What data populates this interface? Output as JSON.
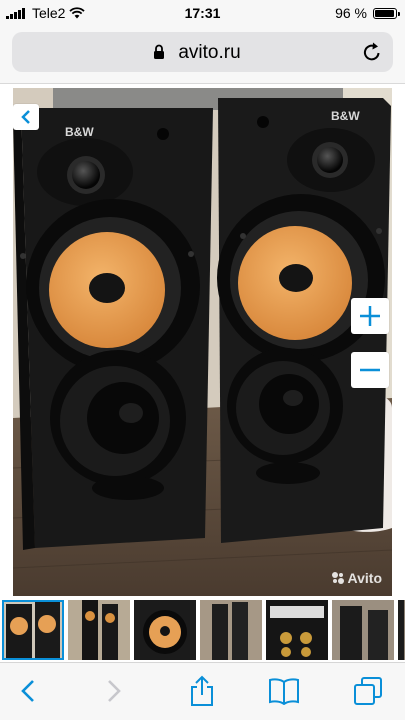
{
  "status": {
    "carrier": "Tele2",
    "time": "17:31",
    "battery_text": "96 %",
    "battery_level": 0.96
  },
  "browser": {
    "url": "avito.ru",
    "icons": {
      "lock": "lock-icon",
      "reload": "reload-icon"
    }
  },
  "gallery": {
    "watermark": "Avito",
    "thumbnail_count": 7,
    "selected_index": 0,
    "controls": {
      "back": "chevron-left-icon",
      "zoom_in": "plus-icon",
      "zoom_out": "minus-icon"
    }
  },
  "colors": {
    "accent": "#0a8fd8",
    "disabled": "#c7c7cc",
    "chrome_bg": "#f7f7f7",
    "speaker_body": "#1c1c1c",
    "woofer_cone": "#eba255"
  },
  "toolbar": {
    "items": [
      "back-icon",
      "forward-icon",
      "share-icon",
      "bookmarks-icon",
      "tabs-icon"
    ]
  }
}
